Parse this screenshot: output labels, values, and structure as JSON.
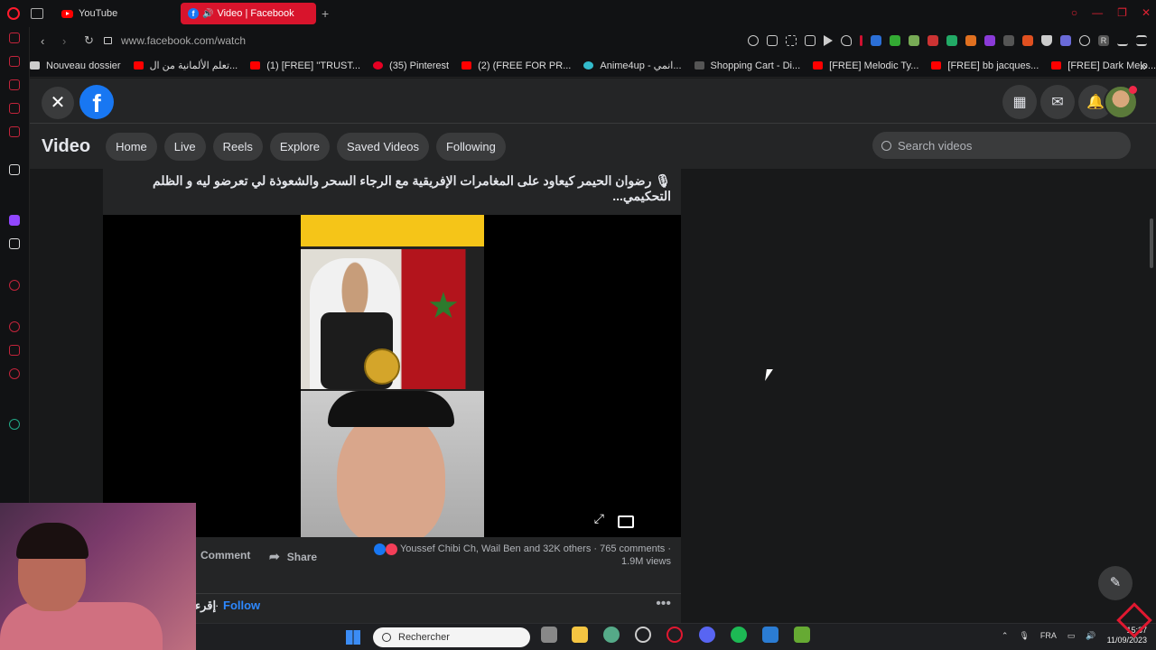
{
  "browser": {
    "tabs": [
      {
        "label": "YouTube"
      },
      {
        "label": "Video | Facebook"
      }
    ],
    "url": "www.facebook.com/watch",
    "bookmarks": [
      {
        "label": "Nouveau dossier"
      },
      {
        "label": "تعلم الألمانية من ال..."
      },
      {
        "label": "(1) [FREE] ''TRUST..."
      },
      {
        "label": "(35) Pinterest"
      },
      {
        "label": "(2) (FREE FOR PR..."
      },
      {
        "label": "Anime4up - انمي..."
      },
      {
        "label": "Shopping Cart - Di..."
      },
      {
        "label": "[FREE] Melodic Ty..."
      },
      {
        "label": "[FREE] bb jacques..."
      },
      {
        "label": "[FREE] Dark Melo..."
      }
    ],
    "bookmarks_more": "»"
  },
  "facebook": {
    "close_glyph": "✕",
    "logo": "f",
    "section_title": "Video",
    "nav_pills": [
      "Home",
      "Live",
      "Reels",
      "Explore",
      "Saved Videos",
      "Following"
    ],
    "search_placeholder": "Search videos",
    "post": {
      "title": "🎙 رضوان الحيمر كيعاود على المغامرات الإفريقية مع الرجاء السحر والشعوذة لي تعرضو ليه و الظلم التحكيمي...",
      "comment_label": "Comment",
      "share_label": "Share",
      "reactions_text": "Youssef Chibi Ch, Wail Ben and 32K others",
      "comments_count": "765 comments",
      "views": "1.9M views",
      "author_partial": "إقرء",
      "follow_label": "Follow",
      "more_glyph": "•••"
    }
  },
  "taskbar": {
    "search_placeholder": "Rechercher",
    "language": "FRA",
    "time": "15:37",
    "date": "11/09/2023"
  }
}
